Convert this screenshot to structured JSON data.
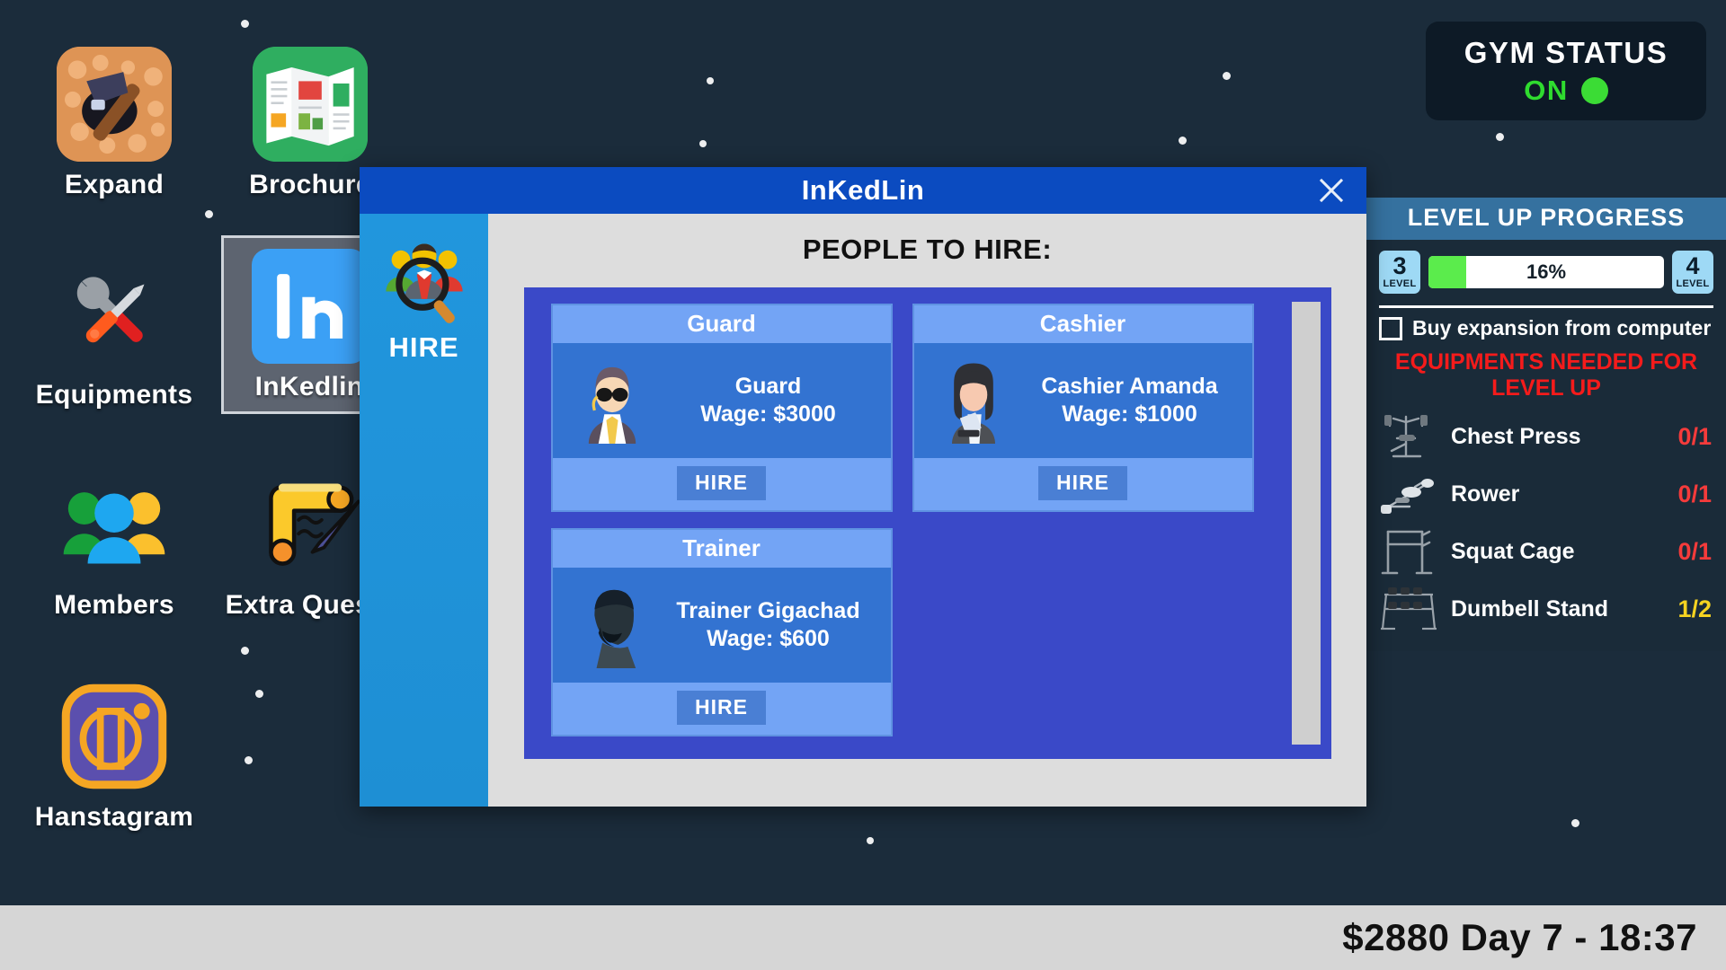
{
  "desktop": {
    "icons": [
      {
        "label": "Expand",
        "icon": "pickaxe-rocks-icon"
      },
      {
        "label": "Brochure",
        "icon": "brochure-icon"
      },
      {
        "label": "Equipments",
        "icon": "tools-icon"
      },
      {
        "label": "InKedlin",
        "icon": "inkedlin-icon",
        "selected": true
      },
      {
        "label": "Members",
        "icon": "members-group-icon"
      },
      {
        "label": "Extra Quests",
        "icon": "scroll-quill-icon"
      },
      {
        "label": "Hanstagram",
        "icon": "hanstagram-icon"
      }
    ]
  },
  "modal": {
    "title": "InKedLin",
    "close_label": "close-window",
    "sidebar": {
      "tabs": [
        {
          "label": "HIRE",
          "icon": "people-search-icon",
          "active": true
        }
      ]
    },
    "heading": "PEOPLE TO HIRE:",
    "cards": [
      {
        "role": "Guard",
        "name": "Guard",
        "wage": "Wage: $3000",
        "button": "HIRE",
        "avatar": "guard-sunglasses-avatar"
      },
      {
        "role": "Cashier",
        "name": "Cashier Amanda",
        "wage": "Wage: $1000",
        "button": "HIRE",
        "avatar": "cashier-woman-avatar"
      },
      {
        "role": "Trainer",
        "name": "Trainer Gigachad",
        "wage": "Wage: $600",
        "button": "HIRE",
        "avatar": "trainer-gigachad-avatar"
      }
    ]
  },
  "hud": {
    "gym_status": {
      "title": "GYM STATUS",
      "value": "ON",
      "led_color": "#3bdc35"
    },
    "level_panel": {
      "header": "LEVEL UP PROGRESS",
      "current_level": "3",
      "next_level": "4",
      "level_word": "LEVEL",
      "progress_text": "16%",
      "progress_percent": 16,
      "progress_color": "#5bec4c",
      "expansion_label": "Buy expansion from computer",
      "expansion_checked": false,
      "equipment_title": "EQUIPMENTS NEEDED FOR LEVEL UP",
      "equipment_title_color": "#f51b1b",
      "equipment": [
        {
          "name": "Chest Press",
          "count": "0/1",
          "color": "#f53b3b",
          "icon": "chest-press-icon"
        },
        {
          "name": "Rower",
          "count": "0/1",
          "color": "#f53b3b",
          "icon": "rower-icon"
        },
        {
          "name": "Squat Cage",
          "count": "0/1",
          "color": "#f53b3b",
          "icon": "squat-cage-icon"
        },
        {
          "name": "Dumbell Stand",
          "count": "1/2",
          "color": "#f5d321",
          "icon": "dumbell-stand-icon"
        }
      ]
    }
  },
  "statusbar": {
    "money_clock": "$2880 Day 7 - 18:37"
  }
}
